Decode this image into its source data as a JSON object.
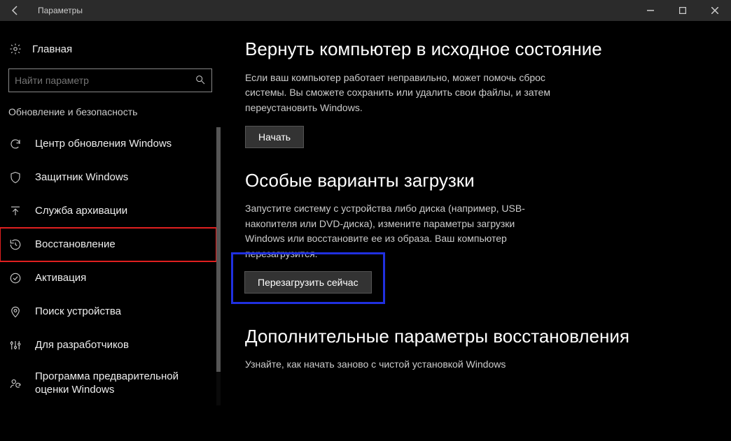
{
  "window": {
    "title": "Параметры"
  },
  "sidebar": {
    "home": "Главная",
    "search_placeholder": "Найти параметр",
    "category": "Обновление и безопасность",
    "items": [
      {
        "label": "Центр обновления Windows"
      },
      {
        "label": "Защитник Windows"
      },
      {
        "label": "Служба архивации"
      },
      {
        "label": "Восстановление"
      },
      {
        "label": "Активация"
      },
      {
        "label": "Поиск устройства"
      },
      {
        "label": "Для разработчиков"
      },
      {
        "label": "Программа предварительной оценки Windows"
      }
    ]
  },
  "sections": {
    "reset": {
      "heading": "Вернуть компьютер в исходное состояние",
      "body": "Если ваш компьютер работает неправильно, может помочь сброс системы. Вы сможете сохранить или удалить свои файлы, и затем переустановить Windows.",
      "button": "Начать"
    },
    "advanced": {
      "heading": "Особые варианты загрузки",
      "body": "Запустите систему с устройства либо диска (например, USB-накопителя или DVD-диска), измените параметры загрузки Windows или восстановите ее из образа. Ваш компьютер перезагрузится.",
      "button": "Перезагрузить сейчас"
    },
    "more": {
      "heading": "Дополнительные параметры восстановления",
      "body": "Узнайте, как начать заново с чистой установкой Windows"
    }
  }
}
